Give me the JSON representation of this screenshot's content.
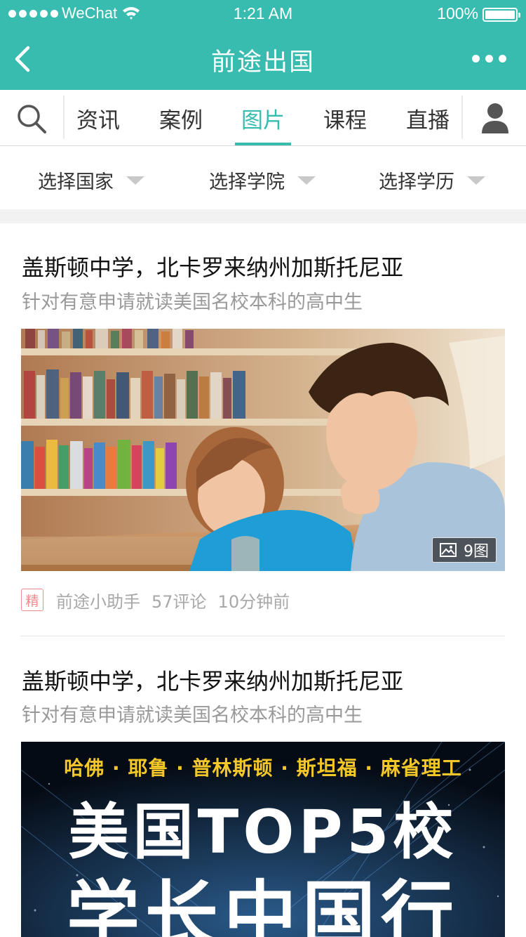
{
  "status_bar": {
    "carrier": "WeChat",
    "time": "1:21 AM",
    "battery": "100%"
  },
  "nav": {
    "title": "前途出国"
  },
  "tabs": [
    {
      "label": "资讯"
    },
    {
      "label": "案例"
    },
    {
      "label": "图片"
    },
    {
      "label": "课程"
    },
    {
      "label": "直播"
    }
  ],
  "filters": [
    {
      "label": "选择国家"
    },
    {
      "label": "选择学院"
    },
    {
      "label": "选择学历"
    }
  ],
  "articles": [
    {
      "title": "盖斯顿中学，北卡罗来纳州加斯托尼亚",
      "subtitle": "针对有意申请就读美国名校本科的高中生",
      "photo_count": "9图",
      "badge": "精",
      "author": "前途小助手",
      "comments": "57评论",
      "time": "10分钟前"
    },
    {
      "title": "盖斯顿中学，北卡罗来纳州加斯托尼亚",
      "subtitle": "针对有意申请就读美国名校本科的高中生",
      "poster": {
        "line1": "哈佛 · 耶鲁 · 普林斯顿 · 斯坦福 · 麻省理工",
        "line2": "美国TOP5校",
        "line3": "学长中国行"
      }
    }
  ],
  "colors": {
    "accent": "#39bcb0",
    "badge": "#f08a8a"
  }
}
